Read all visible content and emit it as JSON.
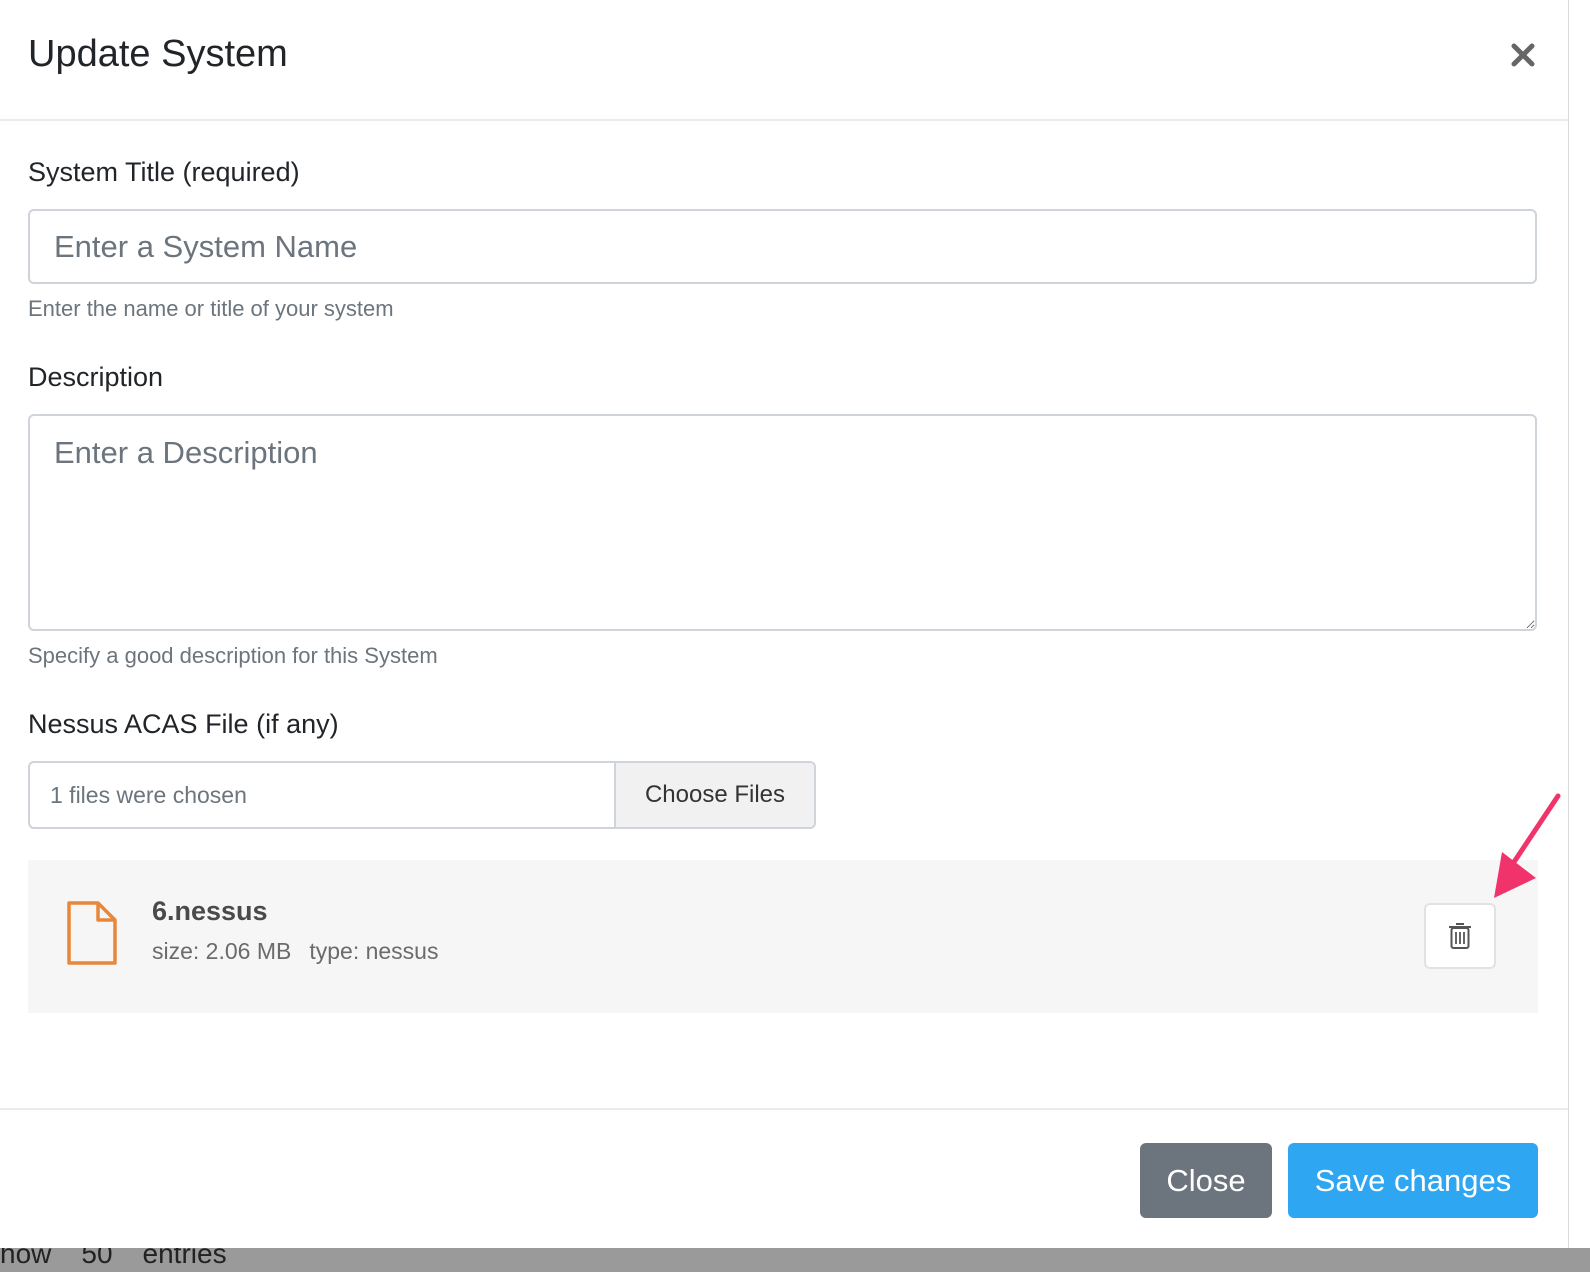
{
  "modal": {
    "title": "Update System"
  },
  "form": {
    "system_title": {
      "label": "System Title (required)",
      "placeholder": "Enter a System Name",
      "value": "",
      "help": "Enter the name or title of your system"
    },
    "description": {
      "label": "Description",
      "placeholder": "Enter a Description",
      "value": "",
      "help": "Specify a good description for this System"
    },
    "file_upload": {
      "label": "Nessus ACAS File (if any)",
      "status_text": "1 files were chosen",
      "button_label": "Choose Files"
    },
    "uploaded_files": [
      {
        "name": "6.nessus",
        "size": "size: 2.06 MB",
        "type": "type: nessus"
      }
    ]
  },
  "footer": {
    "close_label": "Close",
    "save_label": "Save changes"
  },
  "background": {
    "text_parts": [
      "how",
      "50",
      "entries"
    ]
  },
  "icons": {
    "close": "close-icon",
    "file": "file-icon",
    "trash": "trash-icon",
    "annotation_arrow": "arrow-icon"
  },
  "colors": {
    "primary": "#2ea6f2",
    "secondary": "#6c757d",
    "file_icon": "#e8873a",
    "annotation": "#f0336b"
  }
}
